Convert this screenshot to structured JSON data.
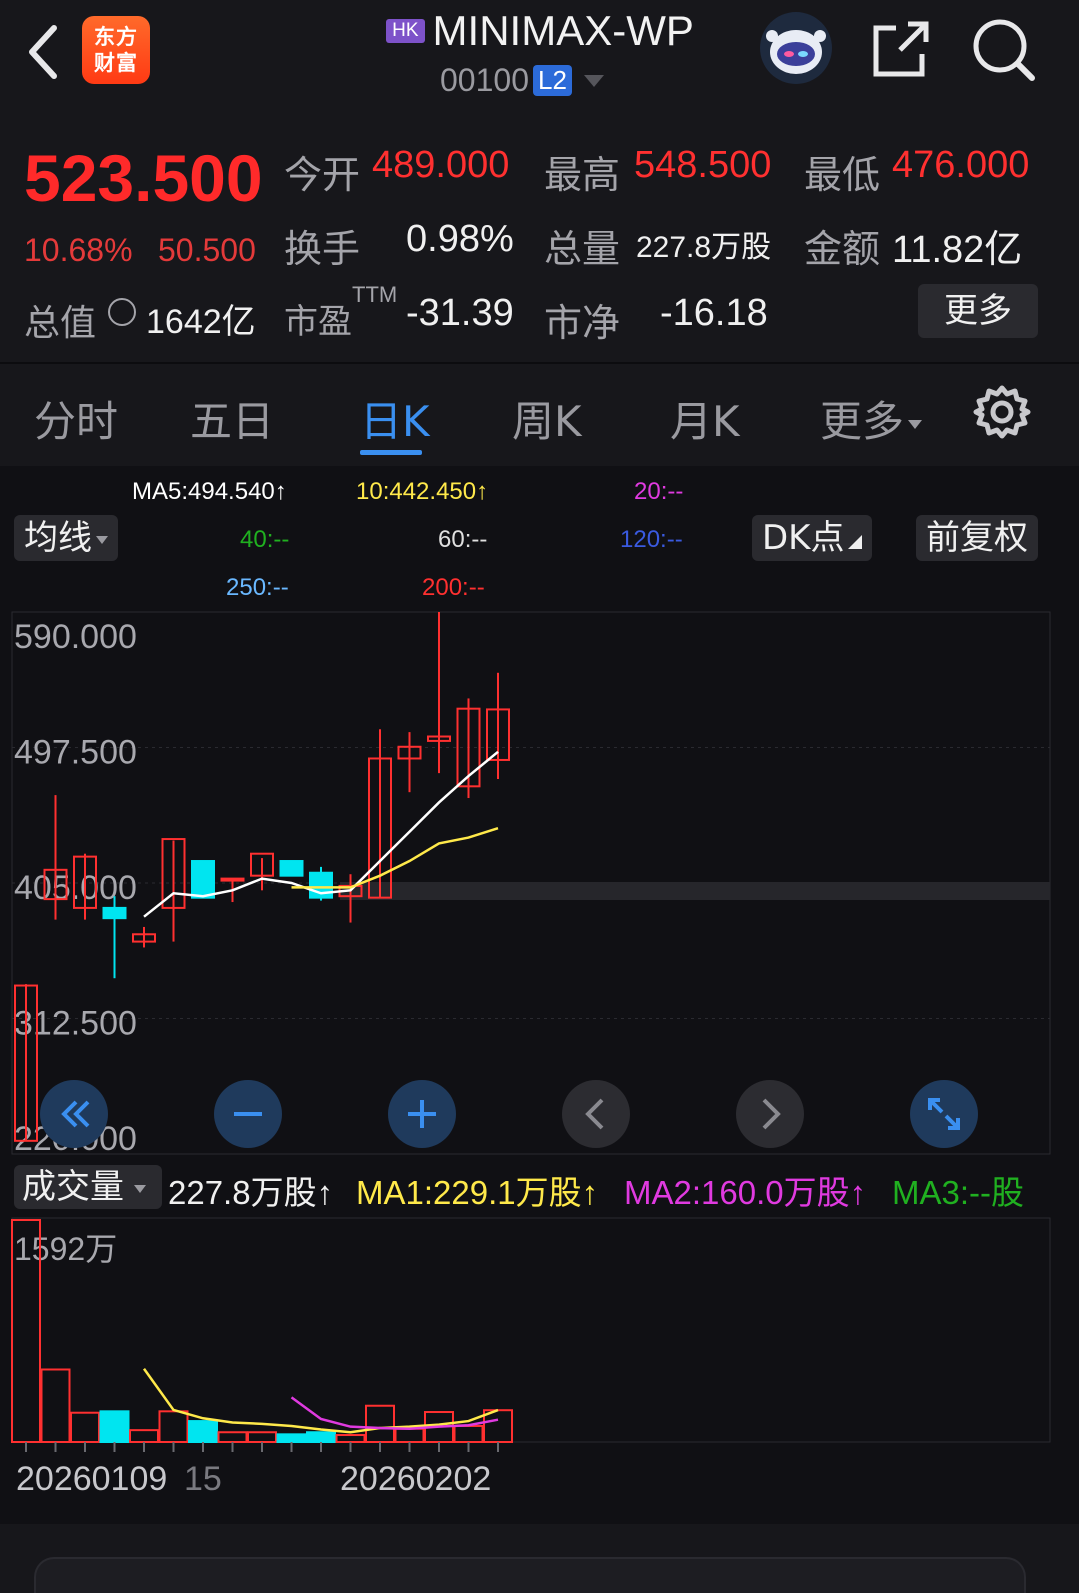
{
  "header": {
    "logo_text": "东方\n财富",
    "market_badge": "HK",
    "title": "MINIMAX-WP",
    "code": "00100",
    "level_badge": "L2"
  },
  "quote": {
    "price": "523.500",
    "change_pct": "10.68%",
    "change_amt": "50.500",
    "open_label": "今开",
    "open": "489.000",
    "high_label": "最高",
    "high": "548.500",
    "low_label": "最低",
    "low": "476.000",
    "turnover_label": "换手",
    "turnover": "0.98%",
    "volume_label": "总量",
    "volume": "227.8万股",
    "amount_label": "金额",
    "amount": "11.82亿",
    "mcap_label": "总值",
    "mcap": "1642亿",
    "pe_label": "市盈",
    "pe_sup": "TTM",
    "pe": "-31.39",
    "pb_label": "市净",
    "pb": "-16.18",
    "more_label": "更多"
  },
  "tabs": [
    {
      "label": "分时"
    },
    {
      "label": "五日"
    },
    {
      "label": "日K"
    },
    {
      "label": "周K"
    },
    {
      "label": "月K"
    },
    {
      "label": "更多"
    }
  ],
  "ma": {
    "ma5": "MA5:494.540↑",
    "ma10": "10:442.450↑",
    "ma20": "20:--",
    "ma40": "40:--",
    "ma60": "60:--",
    "ma120": "120:--",
    "ma250": "250:--",
    "ma200": "200:--",
    "indicator_label": "均线",
    "dk_label": "DK点",
    "adjust_label": "前复权"
  },
  "colors": {
    "up": "#ff3030",
    "down": "#00e5f0",
    "ma5": "#ffffff",
    "ma10": "#ffe94a",
    "ma20": "#e03ae0",
    "ma40": "#20b020",
    "ma60": "#e0e0e0",
    "ma120": "#3a5ae0",
    "ma250": "#6ab8ff",
    "ma200": "#ff3030"
  },
  "chart_data": {
    "type": "candlestick",
    "y_ticks": [
      "590.000",
      "497.500",
      "405.000",
      "312.500",
      "220.000"
    ],
    "ylim": [
      220,
      590
    ],
    "candles": [
      {
        "o": 229,
        "h": 336,
        "l": 229,
        "c": 335
      },
      {
        "o": 394,
        "h": 465,
        "l": 380,
        "c": 414
      },
      {
        "o": 388,
        "h": 425,
        "l": 380,
        "c": 423
      },
      {
        "o": 388,
        "h": 396,
        "l": 340,
        "c": 381
      },
      {
        "o": 365,
        "h": 375,
        "l": 361,
        "c": 370
      },
      {
        "o": 388,
        "h": 434,
        "l": 365,
        "c": 435
      },
      {
        "o": 420,
        "h": 420,
        "l": 395,
        "c": 395
      },
      {
        "o": 408,
        "h": 408,
        "l": 392,
        "c": 408
      },
      {
        "o": 410,
        "h": 422,
        "l": 400,
        "c": 425
      },
      {
        "o": 420,
        "h": 420,
        "l": 410,
        "c": 410
      },
      {
        "o": 412,
        "h": 416,
        "l": 393,
        "c": 395
      },
      {
        "o": 396,
        "h": 411,
        "l": 378,
        "c": 403
      },
      {
        "o": 395,
        "h": 510,
        "l": 395,
        "c": 490
      },
      {
        "o": 490,
        "h": 508,
        "l": 467,
        "c": 498
      },
      {
        "o": 502,
        "h": 590,
        "l": 480,
        "c": 505
      },
      {
        "o": 471,
        "h": 531,
        "l": 463,
        "c": 524
      },
      {
        "o": 489,
        "h": 548.5,
        "l": 476,
        "c": 523.5
      }
    ],
    "ma5_line": [
      null,
      null,
      null,
      null,
      382,
      398,
      396,
      400,
      408,
      405,
      398,
      400,
      420,
      440,
      460,
      478,
      494.54
    ],
    "ma10_line": [
      null,
      null,
      null,
      null,
      null,
      null,
      null,
      null,
      null,
      402,
      402,
      402,
      410,
      420,
      432,
      436,
      442.45
    ],
    "volume": {
      "label": "成交量",
      "current": "227.8万股↑",
      "ma1": "MA1:229.1万股↑",
      "ma2": "MA2:160.0万股↑",
      "ma3": "MA3:--股",
      "max_label": "1592万",
      "max": 1592,
      "bars": [
        1592,
        520,
        210,
        220,
        85,
        220,
        150,
        70,
        70,
        55,
        70,
        50,
        260,
        95,
        215,
        115,
        228
      ],
      "ma1_line": [
        null,
        null,
        null,
        null,
        525,
        230,
        170,
        140,
        130,
        115,
        90,
        70,
        100,
        110,
        125,
        150,
        229
      ],
      "ma2_line": [
        null,
        null,
        null,
        null,
        null,
        null,
        null,
        null,
        null,
        320,
        165,
        110,
        100,
        95,
        110,
        120,
        160
      ]
    },
    "x_labels": [
      "20260109",
      "15",
      "20260202"
    ]
  },
  "bottom": {}
}
